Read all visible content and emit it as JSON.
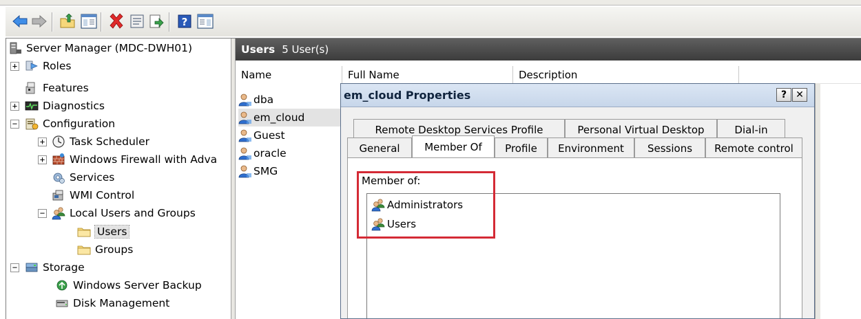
{
  "toolbar": {
    "buttons": [
      {
        "name": "back-icon"
      },
      {
        "name": "forward-icon"
      },
      {
        "name": "up-folder-icon"
      },
      {
        "name": "show-hide-tree-icon"
      },
      {
        "name": "delete-icon"
      },
      {
        "name": "properties-icon"
      },
      {
        "name": "export-list-icon"
      },
      {
        "name": "help-icon"
      },
      {
        "name": "show-hide-action-pane-icon"
      }
    ]
  },
  "tree": {
    "root": "Server Manager (MDC-DWH01)",
    "roles": "Roles",
    "features": "Features",
    "diagnostics": "Diagnostics",
    "configuration": "Configuration",
    "task_scheduler": "Task Scheduler",
    "firewall": "Windows Firewall with Adva",
    "services": "Services",
    "wmi": "WMI Control",
    "local_users": "Local Users and Groups",
    "users": "Users",
    "groups": "Groups",
    "storage": "Storage",
    "backup": "Windows Server Backup",
    "disk": "Disk Management"
  },
  "right_pane": {
    "title": "Users",
    "count": "5 User(s)",
    "columns": [
      "Name",
      "Full Name",
      "Description"
    ],
    "users": [
      "dba",
      "em_cloud",
      "Guest",
      "oracle",
      "SMG"
    ]
  },
  "dialog": {
    "title": "em_cloud Properties",
    "help_btn": "?",
    "close_btn": "✕",
    "tabs_row1": [
      "Remote Desktop Services Profile",
      "Personal Virtual Desktop",
      "Dial-in"
    ],
    "tabs_row2": [
      "General",
      "Member Of",
      "Profile",
      "Environment",
      "Sessions",
      "Remote control"
    ],
    "member_of_label": "Member of:",
    "groups": [
      "Administrators",
      "Users"
    ]
  },
  "colors": {
    "highlight": "#d42a35",
    "header_bg": "#4a4a4a"
  }
}
